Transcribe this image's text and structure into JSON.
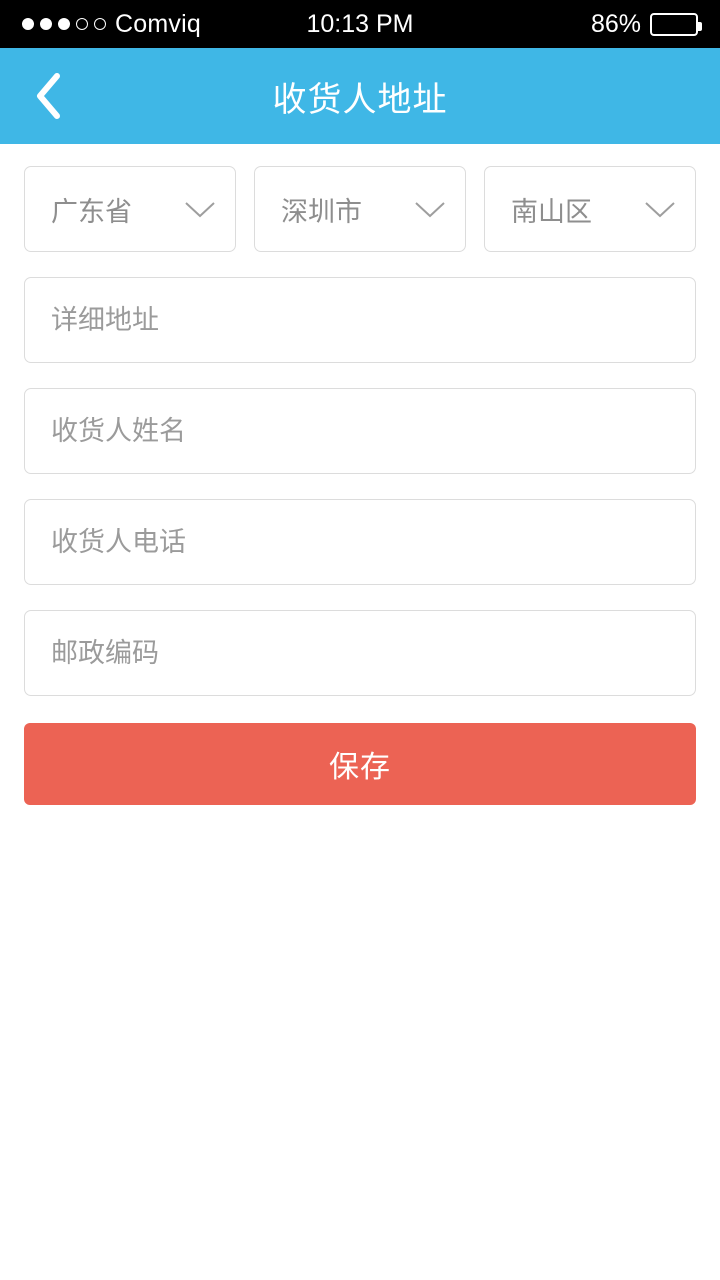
{
  "status_bar": {
    "carrier": "Comviq",
    "signal_dots_total": 5,
    "signal_dots_filled": 3,
    "time": "10:13 PM",
    "battery_percent_label": "86%",
    "battery_level": 86,
    "background_color": "#000000",
    "text_color": "#ffffff"
  },
  "header": {
    "title": "收货人地址",
    "back_icon": "chevron-left-icon",
    "background_color": "#3fb7e6",
    "text_color": "#ffffff"
  },
  "form": {
    "region_selects": [
      {
        "value": "广东省",
        "icon": "chevron-down-icon"
      },
      {
        "value": "深圳市",
        "icon": "chevron-down-icon"
      },
      {
        "value": "南山区",
        "icon": "chevron-down-icon"
      }
    ],
    "fields": [
      {
        "placeholder": "详细地址",
        "value": ""
      },
      {
        "placeholder": "收货人姓名",
        "value": ""
      },
      {
        "placeholder": "收货人电话",
        "value": ""
      },
      {
        "placeholder": "邮政编码",
        "value": ""
      }
    ],
    "save_label": "保存",
    "save_color": "#ec6354",
    "border_color": "#dcdcdc",
    "placeholder_color": "#9b9b9b"
  }
}
